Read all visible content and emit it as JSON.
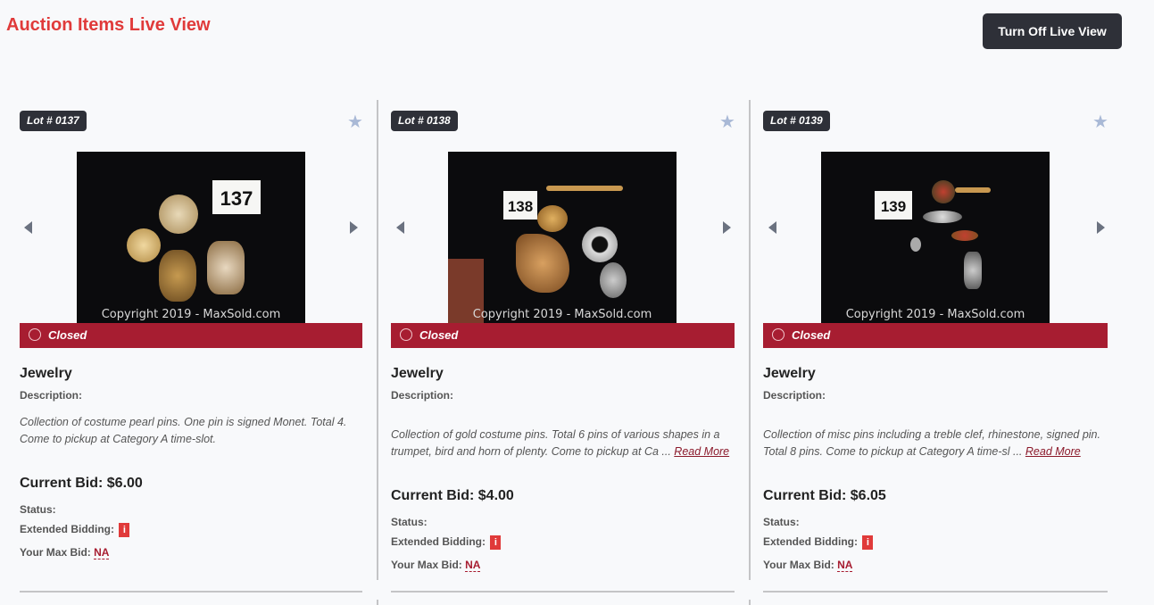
{
  "header": {
    "title": "Auction Items Live View",
    "toggle_button": "Turn Off Live View"
  },
  "colors": {
    "title_red": "#e03a3a",
    "closed_bar": "#a71d31",
    "badge_dark": "#2e3038",
    "star": "#a9b9d6"
  },
  "lots": [
    {
      "lot": "Lot # 0137",
      "tag_number": "137",
      "copyright": "Copyright 2019 - MaxSold.com",
      "state": "Closed",
      "title": "Jewelry",
      "description_label": "Description:",
      "description": "Collection of costume pearl pins. One pin is signed Monet. Total 4. Come to pickup at Category A time-slot.",
      "read_more": "",
      "current_bid": "Current Bid: $6.00",
      "status_label": "Status:",
      "extended_label": "Extended Bidding:",
      "info_icon": "i",
      "max_bid_label": "Your Max Bid:",
      "max_bid_value": "NA"
    },
    {
      "lot": "Lot # 0138",
      "tag_number": "138",
      "copyright": "Copyright 2019 - MaxSold.com",
      "state": "Closed",
      "title": "Jewelry",
      "description_label": "Description:",
      "description": "Collection of gold costume pins. Total 6 pins of various shapes in a trumpet, bird and horn of plenty. Come to pickup at Ca ... ",
      "read_more": "Read More",
      "current_bid": "Current Bid: $4.00",
      "status_label": "Status:",
      "extended_label": "Extended Bidding:",
      "info_icon": "i",
      "max_bid_label": "Your Max Bid:",
      "max_bid_value": "NA"
    },
    {
      "lot": "Lot # 0139",
      "tag_number": "139",
      "copyright": "Copyright 2019 - MaxSold.com",
      "state": "Closed",
      "title": "Jewelry",
      "description_label": "Description:",
      "description": "Collection of misc pins including a treble clef, rhinestone, signed pin. Total 8 pins. Come to pickup at Category A time-sl ... ",
      "read_more": "Read More",
      "current_bid": "Current Bid: $6.05",
      "status_label": "Status:",
      "extended_label": "Extended Bidding:",
      "info_icon": "i",
      "max_bid_label": "Your Max Bid:",
      "max_bid_value": "NA"
    }
  ]
}
